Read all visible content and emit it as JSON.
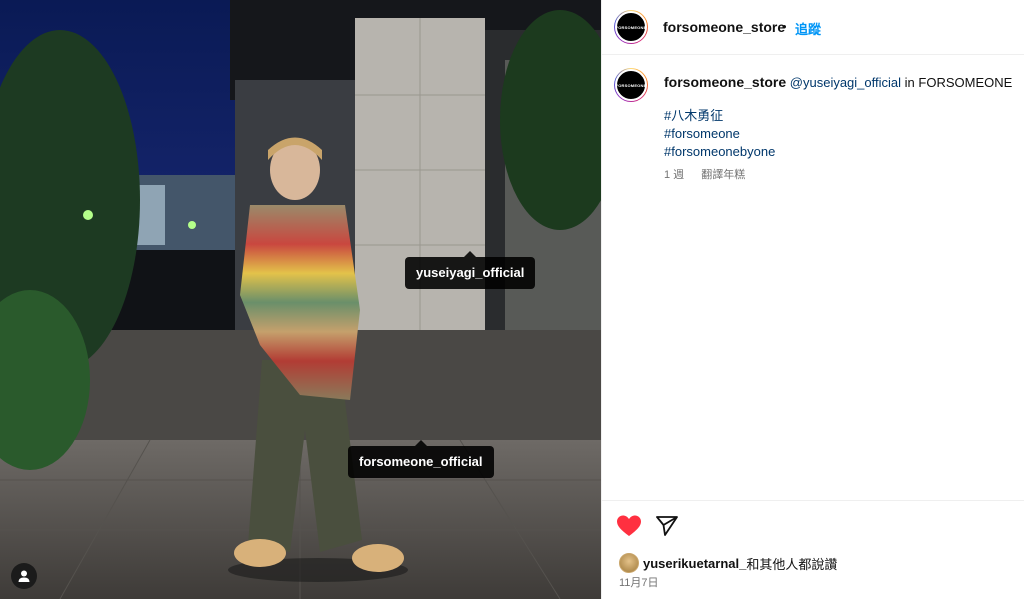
{
  "post": {
    "account": "forsomeone_store",
    "follow_label": "追蹤",
    "separator": "•",
    "avatar_text": "FORSOMEONE",
    "caption": {
      "author": "forsomeone_store",
      "mention": "@yuseiyagi_official",
      "location_prefix": "in",
      "location": "FORSOMEONE",
      "hashtags": [
        "#八木勇征",
        "#forsomeone",
        "#forsomeonebyone"
      ]
    },
    "time_ago": "1 週",
    "translate_label": "翻譯年糕",
    "likes": {
      "user": "yuserikuetarnal_",
      "suffix": "和其他人都說讚"
    },
    "date": "11月7日"
  },
  "photo_tags": [
    "yuseiyagi_official",
    "forsomeone_official"
  ],
  "colors": {
    "like": "#ff3040",
    "follow": "#0095f6",
    "link": "#00376b"
  },
  "icons": {
    "like": "heart-icon",
    "share": "paper-plane-icon",
    "user_tags": "user-icon"
  }
}
